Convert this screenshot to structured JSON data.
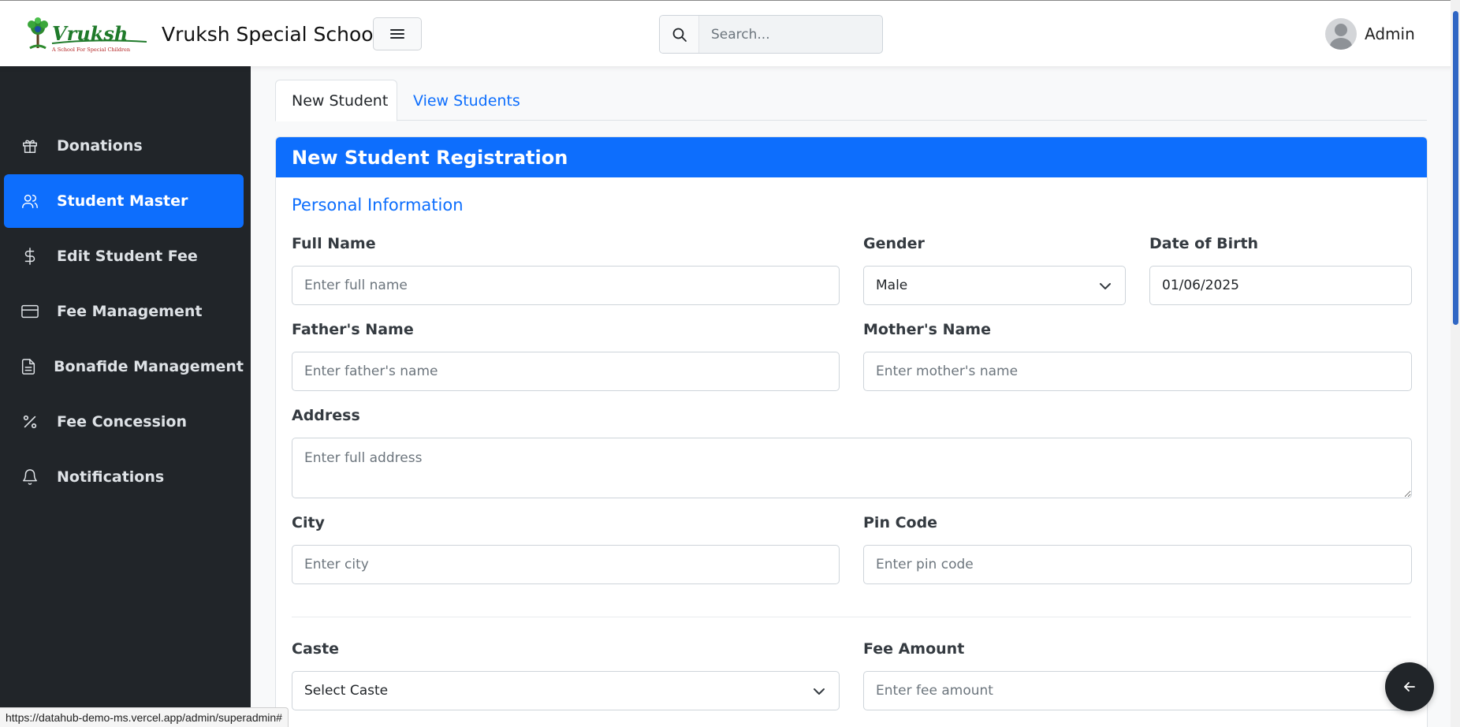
{
  "header": {
    "logo_text": "Vruksh",
    "logo_tagline": "A School For Special Children",
    "school_name": "Vruksh Special School",
    "search_placeholder": "Search...",
    "user_name": "Admin"
  },
  "sidebar": {
    "items": [
      {
        "label": "Donations",
        "icon": "gift-icon"
      },
      {
        "label": "Student Master",
        "icon": "users-icon",
        "active": true
      },
      {
        "label": "Edit Student Fee",
        "icon": "dollar-icon"
      },
      {
        "label": "Fee Management",
        "icon": "credit-card-icon"
      },
      {
        "label": "Bonafide Management",
        "icon": "document-icon"
      },
      {
        "label": "Fee Concession",
        "icon": "percent-icon"
      },
      {
        "label": "Notifications",
        "icon": "bell-icon"
      }
    ]
  },
  "tabs": {
    "new_student": "New Student",
    "view_students": "View Students"
  },
  "form": {
    "title": "New Student Registration",
    "section_personal": "Personal Information",
    "full_name": {
      "label": "Full Name",
      "placeholder": "Enter full name"
    },
    "gender": {
      "label": "Gender",
      "value": "Male"
    },
    "dob": {
      "label": "Date of Birth",
      "value": "01/06/2025"
    },
    "father_name": {
      "label": "Father's Name",
      "placeholder": "Enter father's name"
    },
    "mother_name": {
      "label": "Mother's Name",
      "placeholder": "Enter mother's name"
    },
    "address": {
      "label": "Address",
      "placeholder": "Enter full address"
    },
    "city": {
      "label": "City",
      "placeholder": "Enter city"
    },
    "pin_code": {
      "label": "Pin Code",
      "placeholder": "Enter pin code"
    },
    "caste": {
      "label": "Caste",
      "value": "Select Caste"
    },
    "fee_amount": {
      "label": "Fee Amount",
      "placeholder": "Enter fee amount"
    }
  },
  "status_bar": {
    "url": "https://datahub-demo-ms.vercel.app/admin/superadmin#"
  },
  "colors": {
    "primary": "#0d6efd",
    "sidebar_bg": "#212529"
  }
}
